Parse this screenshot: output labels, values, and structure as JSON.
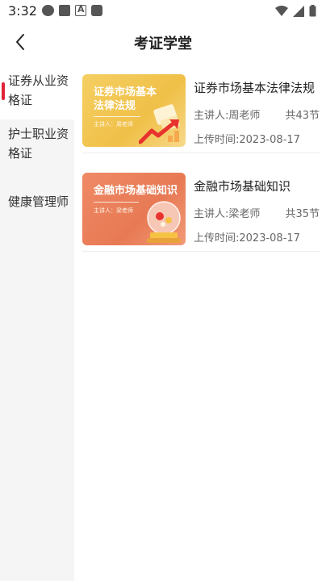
{
  "status_bar": {
    "time": "3:32",
    "icons": [
      "settings-icon",
      "image-icon",
      "a-icon",
      "square-icon",
      "wifi-icon",
      "signal-icon",
      "battery-icon"
    ]
  },
  "header": {
    "title": "考证学堂",
    "back_icon": "back-icon"
  },
  "sidebar": {
    "items": [
      {
        "label_line1": "证券从业资",
        "label_line2": "格证",
        "active": true
      },
      {
        "label_line1": "护士职业资",
        "label_line2": "格证",
        "active": false
      },
      {
        "label_line1": "健康管理师",
        "label_line2": "",
        "active": false
      }
    ]
  },
  "courses": [
    {
      "thumb_title_line1": "证券市场基本",
      "thumb_title_line2": "法律法规",
      "thumb_lecturer": "主讲人：周老师",
      "title": "证券市场基本法律法规",
      "lecturer": "主讲人:周老师",
      "count": "共43节",
      "date": "上传时间:2023-08-17",
      "theme": "gold"
    },
    {
      "thumb_title_line1": "金融市场基础知识",
      "thumb_title_line2": "",
      "thumb_lecturer": "主讲人：梁老师",
      "title": "金融市场基础知识",
      "lecturer": "主讲人:梁老师",
      "count": "共35节",
      "date": "上传时间:2023-08-17",
      "theme": "orange"
    }
  ],
  "colors": {
    "accent": "#e0243a",
    "sidebar_bg": "#f5f5f6",
    "thumb_gold": "#f2c552",
    "thumb_orange": "#eb8260"
  }
}
